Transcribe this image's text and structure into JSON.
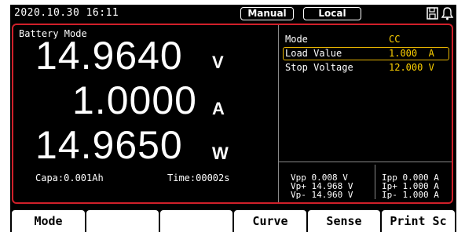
{
  "status_bar": {
    "datetime": "2020.10.30 16:11",
    "mode_badge": "Manual",
    "control_badge": "Local",
    "icons": [
      "save-icon",
      "bell-icon"
    ]
  },
  "main": {
    "mode_title": "Battery Mode",
    "voltage": "14.9640",
    "voltage_unit": "V",
    "current": "1.0000",
    "current_unit": "A",
    "power": "14.9650",
    "power_unit": "W",
    "capacity": "Capa:0.001Ah",
    "time": "Time:00002s"
  },
  "params": [
    {
      "label": "Mode",
      "value": "CC"
    },
    {
      "label": "Load Value",
      "value": "1.000  A"
    },
    {
      "label": "Stop Voltage",
      "value": "12.000 V"
    }
  ],
  "measurements": {
    "left": [
      "Vpp 0.008 V",
      "Vp+ 14.968 V",
      "Vp- 14.960 V"
    ],
    "right": [
      "Ipp 0.000 A",
      "Ip+ 1.000 A",
      "Ip- 1.000 A"
    ]
  },
  "softkeys": [
    "Mode",
    "",
    "",
    "Curve",
    "Sense",
    "Print Sc"
  ],
  "colors": {
    "frame_accent": "#d0202a",
    "value_text": "#ffd200",
    "selection": "#e8b400"
  }
}
